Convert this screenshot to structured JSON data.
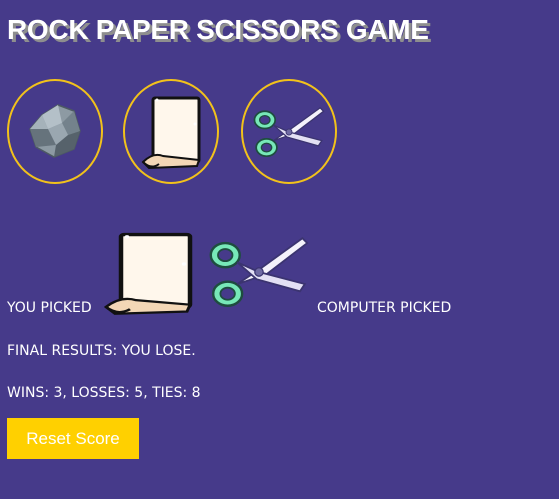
{
  "title": "ROCK PAPER SCISSORS GAME",
  "choices": [
    {
      "name": "rock",
      "icon": "rock-icon"
    },
    {
      "name": "paper",
      "icon": "paper-icon"
    },
    {
      "name": "scissors",
      "icon": "scissors-icon"
    }
  ],
  "result": {
    "you_label": "YOU PICKED",
    "you_pick_icon": "paper-icon",
    "computer_label": "COMPUTER PICKED",
    "computer_pick_icon": "scissors-icon",
    "final_text": "FINAL RESULTS: YOU LOSE.",
    "score_text": "WINS: 3, LOSSES: 5, TIES: 8"
  },
  "reset_label": "Reset Score",
  "colors": {
    "background": "#463a8a",
    "ring": "#f2c21b",
    "button": "#ffd000",
    "text": "#ffffff"
  }
}
